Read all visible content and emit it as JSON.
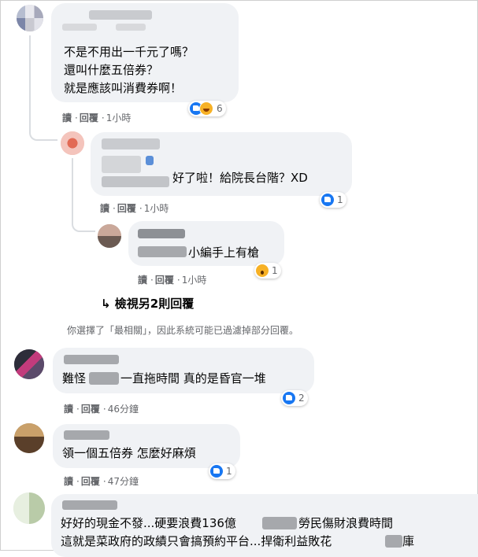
{
  "comments": [
    {
      "lines": [
        "不是不用出一千元了嗎？",
        "還叫什麼五倍券？",
        "就是應該叫消費券啊！"
      ],
      "actions": {
        "read": "讀",
        "reply": "回覆",
        "time": "1小時"
      },
      "reaction_count": "6"
    },
    {
      "text": "好了啦！給院長台階？XD",
      "actions": {
        "read": "讀",
        "reply": "回覆",
        "time": "1小時"
      },
      "reaction_count": "1"
    },
    {
      "text": "小編手上有槍",
      "actions": {
        "read": "讀",
        "reply": "回覆",
        "time": "1小時"
      },
      "reaction_count": "1"
    },
    {
      "text_a": "難怪",
      "text_b": "一直拖時間 真的是昏官一堆",
      "actions": {
        "read": "讀",
        "reply": "回覆",
        "time": "46分鐘"
      },
      "reaction_count": "2"
    },
    {
      "text": "領一個五倍券 怎麼好麻煩",
      "actions": {
        "read": "讀",
        "reply": "回覆",
        "time": "47分鐘"
      },
      "reaction_count": "1"
    },
    {
      "line1_a": "好好的現金不發...硬要浪費136億",
      "line1_b": "勞民傷財浪費時間",
      "line2_a": "這就是菜政府的政績只會搞預約平台...捍衛利益敗花",
      "line2_b": "庫"
    }
  ],
  "more_replies": "↳ 檢視另2則回覆",
  "filter_note": "你選擇了「最相關」，因此系統可能已過濾掉部分回覆。",
  "icons": {
    "like": "like-reaction-icon",
    "haha": "haha-reaction-icon",
    "wow": "wow-reaction-icon",
    "reply_arrow": "reply-arrow-icon"
  }
}
